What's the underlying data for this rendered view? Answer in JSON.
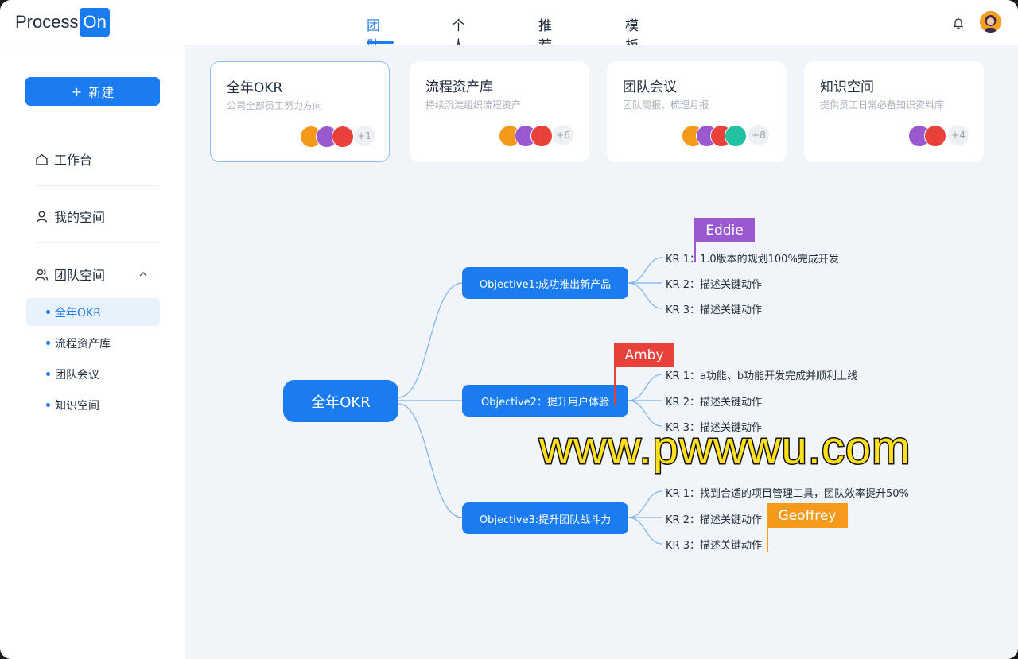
{
  "logo": {
    "text": "Process",
    "badge": "On"
  },
  "nav": {
    "tabs": [
      "团队",
      "个人",
      "推荐",
      "模板"
    ],
    "active": "团队"
  },
  "sidebar": {
    "new_button": "新建",
    "new_icon": "+",
    "items": [
      {
        "label": "工作台",
        "icon": "home-icon"
      },
      {
        "label": "我的空间",
        "icon": "user-icon"
      },
      {
        "label": "团队空间",
        "icon": "team-icon"
      }
    ],
    "sub_items": [
      "全年OKR",
      "流程资产库",
      "团队会议",
      "知识空间"
    ],
    "active_sub": "全年OKR"
  },
  "cards": [
    {
      "title": "全年OKR",
      "subtitle": "公司全部员工努力方向",
      "more": "+1"
    },
    {
      "title": "流程资产库",
      "subtitle": "持续沉淀组织流程资产",
      "more": "+6"
    },
    {
      "title": "团队会议",
      "subtitle": "团队周报、梳理月报",
      "more": "+8"
    },
    {
      "title": "知识空间",
      "subtitle": "提供员工日常必备知识资料库",
      "more": "+4"
    }
  ],
  "mindmap": {
    "root": "全年OKR",
    "objectives": [
      {
        "label": "Objective1:成功推出新产品",
        "krs": [
          "KR 1：1.0版本的规划100%完成开发",
          "KR 2：描述关键动作",
          "KR 3：描述关键动作"
        ]
      },
      {
        "label": "Objective2：提升用户体验",
        "krs": [
          "KR 1：a功能、b功能开发完成并顺利上线",
          "KR 2：描述关键动作",
          "KR 3：描述关键动作"
        ]
      },
      {
        "label": "Objective3:提升团队战斗力",
        "krs": [
          "KR 1：找到合适的项目管理工具，团队效率提升50%",
          "KR 2：描述关键动作",
          "KR 3：描述关键动作"
        ]
      }
    ],
    "cursors": [
      {
        "name": "Eddie",
        "color": "#9b59d0"
      },
      {
        "name": "Amby",
        "color": "#e8413a"
      },
      {
        "name": "Geoffrey",
        "color": "#f59a1b"
      }
    ]
  },
  "watermark": "www.pwwwu.com",
  "colors": {
    "accent": "#1a7cf0",
    "background": "#f1f4f8"
  }
}
